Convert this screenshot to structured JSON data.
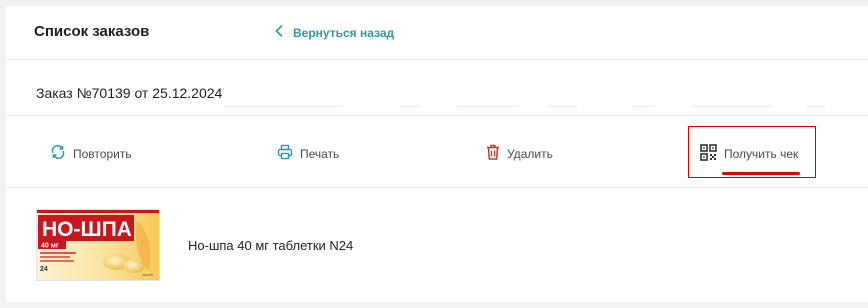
{
  "header": {
    "title": "Список заказов",
    "back_label": "Вернуться назад"
  },
  "order": {
    "title": "Заказ №70139 от 25.12.2024"
  },
  "actions": {
    "repeat_label": "Повторить",
    "print_label": "Печать",
    "delete_label": "Удалить",
    "receipt_label": "Получить чек"
  },
  "product": {
    "name": "Но-шпа 40 мг таблетки N24",
    "package_brand": "НО-ШПА",
    "package_dose": "40 мг",
    "package_count": "24"
  },
  "colors": {
    "accent": "#2f9aa5",
    "delete_icon": "#c0392b",
    "highlight": "#e00000"
  }
}
